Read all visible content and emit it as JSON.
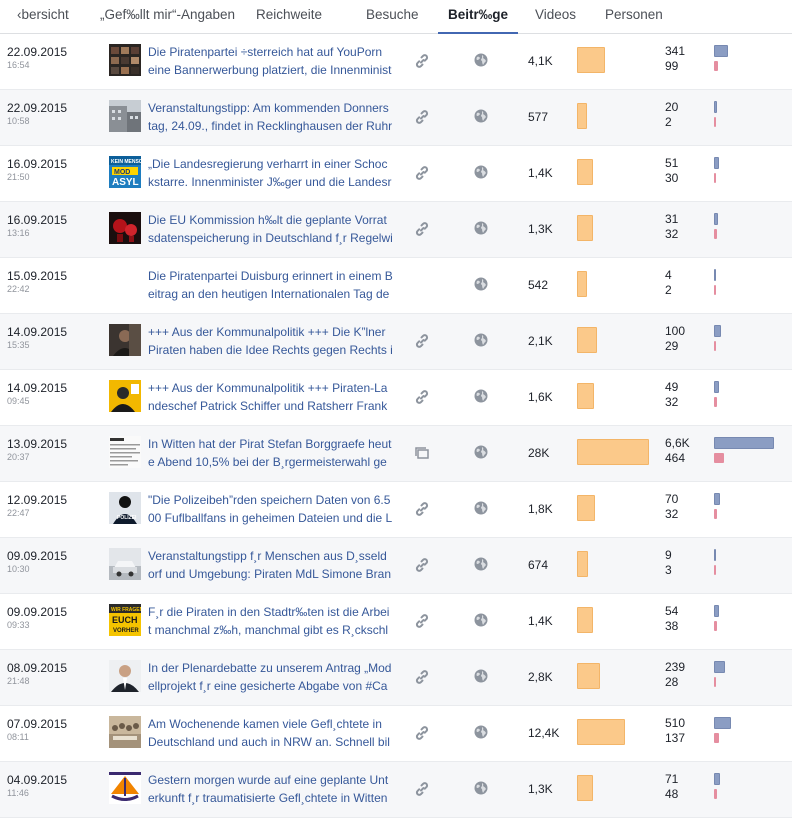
{
  "tabs": [
    {
      "label": "‹bersicht",
      "active": false
    },
    {
      "label": "„Gef‰llt mir“-Angaben",
      "active": false
    },
    {
      "label": "Reichweite",
      "active": false
    },
    {
      "label": "Besuche",
      "active": false
    },
    {
      "label": "Beitr‰ge",
      "active": true
    },
    {
      "label": "Videos",
      "active": false
    },
    {
      "label": "Personen",
      "active": false
    }
  ],
  "posts": [
    {
      "date": "22.09.2015",
      "time": "16:54",
      "text1": "Die Piratenpartei ÷sterreich hat auf YouPorn",
      "text2": "eine Bannerwerbung platziert, die Innenminist",
      "type": "link-icon",
      "reach": "4,1K",
      "reach_value": 4100,
      "eng1": "341",
      "eng2": "99",
      "thumb": "dark-grid"
    },
    {
      "date": "22.09.2015",
      "time": "10:58",
      "text1": "Veranstaltungstipp: Am kommenden Donners",
      "text2": "tag, 24.09., findet in Recklinghausen der Ruhr",
      "type": "link-icon",
      "reach": "577",
      "reach_value": 577,
      "eng1": "20",
      "eng2": "2",
      "thumb": "building"
    },
    {
      "date": "16.09.2015",
      "time": "21:50",
      "text1": "„Die Landesregierung verharrt in einer Schoc",
      "text2": "kstarre. Innenminister J‰ger und die Landesr",
      "type": "link-icon",
      "reach": "1,4K",
      "reach_value": 1400,
      "eng1": "51",
      "eng2": "30",
      "thumb": "asyl"
    },
    {
      "date": "16.09.2015",
      "time": "13:16",
      "text1": "Die EU Kommission h‰lt die geplante Vorrat",
      "text2": "sdatenspeicherung in Deutschland f¸r Regelwi",
      "type": "link-icon",
      "reach": "1,3K",
      "reach_value": 1300,
      "eng1": "31",
      "eng2": "32",
      "thumb": "red-dark"
    },
    {
      "date": "15.09.2015",
      "time": "22:42",
      "text1": "Die Piratenpartei Duisburg erinnert in einem B",
      "text2": "eitrag an den heutigen Internationalen Tag de",
      "type": "none",
      "reach": "542",
      "reach_value": 542,
      "eng1": "4",
      "eng2": "2",
      "thumb": "none"
    },
    {
      "date": "14.09.2015",
      "time": "15:35",
      "text1": "+++ Aus der Kommunalpolitik +++ Die K”lner",
      "text2": "Piraten haben die Idee Rechts gegen Rechts i",
      "type": "link-icon",
      "reach": "2,1K",
      "reach_value": 2100,
      "eng1": "100",
      "eng2": "29",
      "thumb": "person-dark"
    },
    {
      "date": "14.09.2015",
      "time": "09:45",
      "text1": "+++ Aus der Kommunalpolitik +++ Piraten-La",
      "text2": "ndeschef Patrick Schiffer und Ratsherr Frank",
      "type": "link-icon",
      "reach": "1,6K",
      "reach_value": 1600,
      "eng1": "49",
      "eng2": "32",
      "thumb": "yellow-person"
    },
    {
      "date": "13.09.2015",
      "time": "20:37",
      "text1": "In Witten hat der Pirat Stefan Borggraefe heut",
      "text2": "e Abend 10,5% bei der B¸rgermeisterwahl ge",
      "type": "album-icon",
      "reach": "28K",
      "reach_value": 28000,
      "eng1": "6,6K",
      "eng2": "464",
      "thumb": "document"
    },
    {
      "date": "12.09.2015",
      "time": "22:47",
      "text1": "\"Die Polizeibeh”rden speichern Daten von 6.5",
      "text2": "00 Fuflballfans in geheimen Dateien und die L",
      "type": "link-icon",
      "reach": "1,8K",
      "reach_value": 1800,
      "eng1": "70",
      "eng2": "32",
      "thumb": "police"
    },
    {
      "date": "09.09.2015",
      "time": "10:30",
      "text1": "Veranstaltungstipp f¸r Menschen aus D¸sseld",
      "text2": "orf und Umgebung: Piraten MdL Simone Bran",
      "type": "link-icon",
      "reach": "674",
      "reach_value": 674,
      "eng1": "9",
      "eng2": "3",
      "thumb": "car"
    },
    {
      "date": "09.09.2015",
      "time": "09:33",
      "text1": "F¸r die Piraten in den Stadtr‰ten ist die Arbei",
      "text2": "t manchmal z‰h, manchmal gibt es R¸ckschl",
      "type": "link-icon",
      "reach": "1,4K",
      "reach_value": 1400,
      "eng1": "54",
      "eng2": "38",
      "thumb": "yellow-sign"
    },
    {
      "date": "08.09.2015",
      "time": "21:48",
      "text1": "In der Plenardebatte zu unserem Antrag „Mod",
      "text2": "ellprojekt f¸r eine gesicherte Abgabe von #Ca",
      "type": "link-icon",
      "reach": "2,8K",
      "reach_value": 2800,
      "eng1": "239",
      "eng2": "28",
      "thumb": "suit"
    },
    {
      "date": "07.09.2015",
      "time": "08:11",
      "text1": "Am Wochenende kamen viele Gefl¸chtete in",
      "text2": "Deutschland und auch in NRW an. Schnell bil",
      "type": "link-icon",
      "reach": "12,4K",
      "reach_value": 12400,
      "eng1": "510",
      "eng2": "137",
      "thumb": "crowd"
    },
    {
      "date": "04.09.2015",
      "time": "11:46",
      "text1": "Gestern morgen wurde auf eine geplante Unt",
      "text2": "erkunft f¸r traumatisierte Gefl¸chtete in Witten",
      "type": "link-icon",
      "reach": "1,3K",
      "reach_value": 1300,
      "eng1": "71",
      "eng2": "48",
      "thumb": "pirate-logo"
    }
  ],
  "eng_values": [
    [
      341,
      99
    ],
    [
      20,
      2
    ],
    [
      51,
      30
    ],
    [
      31,
      32
    ],
    [
      4,
      2
    ],
    [
      100,
      29
    ],
    [
      49,
      32
    ],
    [
      6600,
      464
    ],
    [
      70,
      32
    ],
    [
      9,
      3
    ],
    [
      54,
      38
    ],
    [
      239,
      28
    ],
    [
      510,
      137
    ],
    [
      71,
      48
    ]
  ],
  "colors": {
    "link": "#365899",
    "reach_bar": "#fbc98a",
    "click_bar": "#8b9dc3",
    "reaction_bar": "#e58ea0",
    "tab_active": "#4267b2"
  },
  "thumb_labels": {
    "asyl_top": "KEIN MENSCH",
    "asyl_mid": "MOD",
    "asyl_bottom": "ASYL",
    "yellow_top": "WIR FRAGEN",
    "yellow_mid": "EUCH",
    "yellow_bottom": "VORHER",
    "police": "POLIZEI"
  }
}
